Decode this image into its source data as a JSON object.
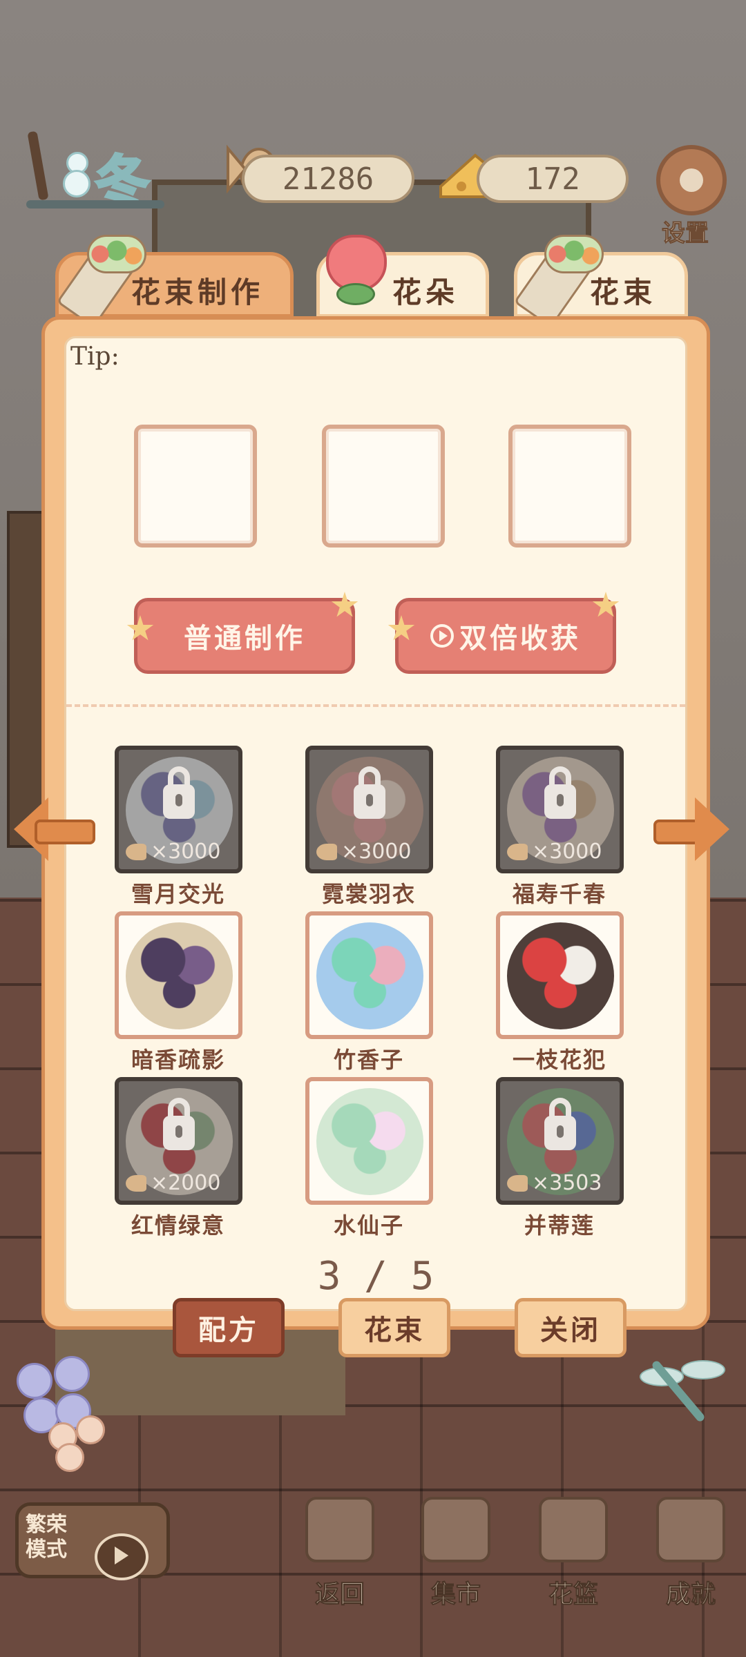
{
  "topbar": {
    "season": "冬",
    "fish_count": "21286",
    "cheese_count": "172",
    "settings_label": "设置"
  },
  "tabs": [
    {
      "label": "花束制作",
      "active": true
    },
    {
      "label": "花朵",
      "active": false
    },
    {
      "label": "花束",
      "active": false
    }
  ],
  "panel": {
    "tip": "Tip:",
    "make_button": "普通制作",
    "double_button": "双倍收获"
  },
  "recipes": [
    {
      "name": "雪月交光",
      "locked": true,
      "cost": "×3000",
      "colors": [
        "#5e5ea8",
        "#8fc6de",
        "#e6eef2"
      ]
    },
    {
      "name": "霓裳羽衣",
      "locked": true,
      "cost": "×3000",
      "colors": [
        "#e28b8a",
        "#f2dccb",
        "#b58d7b"
      ]
    },
    {
      "name": "福寿千春",
      "locked": true,
      "cost": "×3000",
      "colors": [
        "#8a5aa8",
        "#c8a27a",
        "#e4d4bf"
      ]
    },
    {
      "name": "暗香疏影",
      "locked": false,
      "cost": "",
      "colors": [
        "#3b2a4f",
        "#6a4c7e",
        "#d9c7a8"
      ]
    },
    {
      "name": "竹香子",
      "locked": false,
      "cost": "",
      "colors": [
        "#6ed1b3",
        "#e9a6b8",
        "#9cc6ec"
      ]
    },
    {
      "name": "一枝花犯",
      "locked": false,
      "cost": "",
      "colors": [
        "#d8302f",
        "#f0ece6",
        "#3d2b27"
      ]
    },
    {
      "name": "红情绿意",
      "locked": true,
      "cost": "×2000",
      "colors": [
        "#b71b24",
        "#7faa7b",
        "#ede3d4"
      ]
    },
    {
      "name": "水仙子",
      "locked": false,
      "cost": "",
      "colors": [
        "#9cd6b4",
        "#f4d8ee",
        "#cfe6d0"
      ]
    },
    {
      "name": "并蒂莲",
      "locked": true,
      "cost": "×3503",
      "colors": [
        "#d64a4a",
        "#3d6ad0",
        "#6aa86f"
      ]
    }
  ],
  "pagination": "3 / 5",
  "bottom_tabs": {
    "recipe": "配方",
    "bouquet": "花束",
    "close": "关闭"
  },
  "bottom_nav": {
    "mode_label": "繁荣模式",
    "back": "返回",
    "market": "集市",
    "basket": "花篮",
    "achievement": "成就"
  },
  "colors": {
    "panel_bg": "#fef6e5",
    "accent_orange": "#eeb07a",
    "button_red": "#e58074",
    "locked_dark": "#433b36"
  }
}
